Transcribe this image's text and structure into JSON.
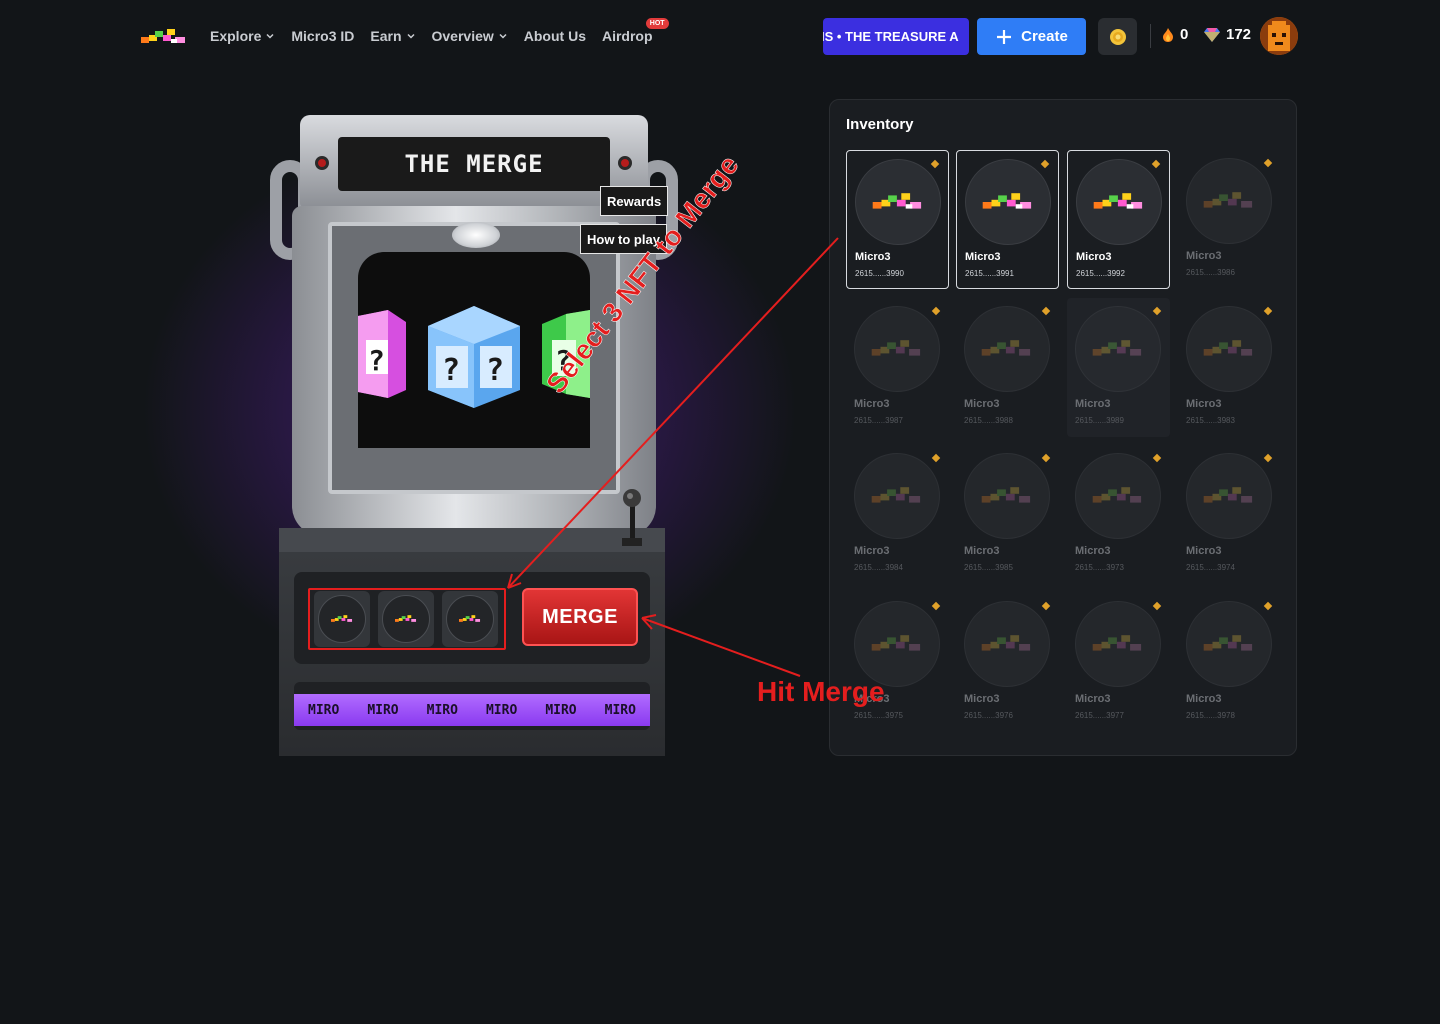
{
  "nav": {
    "items": [
      {
        "label": "Explore",
        "dropdown": true
      },
      {
        "label": "Micro3 ID",
        "dropdown": false
      },
      {
        "label": "Earn",
        "dropdown": true
      },
      {
        "label": "Overview",
        "dropdown": true
      },
      {
        "label": "About Us",
        "dropdown": false
      },
      {
        "label": "Airdrop",
        "dropdown": false,
        "badge": "HOT"
      }
    ]
  },
  "header": {
    "marquee_text": "IS  •  THE TREASURE A",
    "create_label": "Create",
    "flame_count": "0",
    "gem_count": "172"
  },
  "machine": {
    "title": "THE MERGE",
    "rewards_label": "Rewards",
    "how_to_play_label": "How to play",
    "merge_label": "MERGE",
    "band_text": [
      "MIRO",
      "MIRO",
      "MIRO",
      "MIRO",
      "MIRO",
      "MIRO"
    ]
  },
  "inventory": {
    "title": "Inventory",
    "items": [
      {
        "name": "Micro3",
        "id": "2615......3990",
        "selected": true
      },
      {
        "name": "Micro3",
        "id": "2615......3991",
        "selected": true
      },
      {
        "name": "Micro3",
        "id": "2615......3992",
        "selected": true
      },
      {
        "name": "Micro3",
        "id": "2615......3986",
        "selected": false
      },
      {
        "name": "Micro3",
        "id": "2615......3987",
        "selected": false
      },
      {
        "name": "Micro3",
        "id": "2615......3988",
        "selected": false
      },
      {
        "name": "Micro3",
        "id": "2615......3989",
        "selected": false,
        "hover": true
      },
      {
        "name": "Micro3",
        "id": "2615......3983",
        "selected": false
      },
      {
        "name": "Micro3",
        "id": "2615......3984",
        "selected": false
      },
      {
        "name": "Micro3",
        "id": "2615......3985",
        "selected": false
      },
      {
        "name": "Micro3",
        "id": "2615......3973",
        "selected": false
      },
      {
        "name": "Micro3",
        "id": "2615......3974",
        "selected": false
      },
      {
        "name": "Micro3",
        "id": "2615......3975",
        "selected": false
      },
      {
        "name": "Micro3",
        "id": "2615......3976",
        "selected": false
      },
      {
        "name": "Micro3",
        "id": "2615......3977",
        "selected": false
      },
      {
        "name": "Micro3",
        "id": "2615......3978",
        "selected": false
      }
    ]
  },
  "annotations": {
    "select_text": "Select 3 NFT to Merge",
    "hit_text": "Hit Merge"
  },
  "colors": {
    "background": "#121518",
    "accent_blue": "#2f7df6",
    "marquee_bg": "#3b2fe0",
    "merge_red": "#e23535",
    "annotation_red": "#e41e1e"
  }
}
